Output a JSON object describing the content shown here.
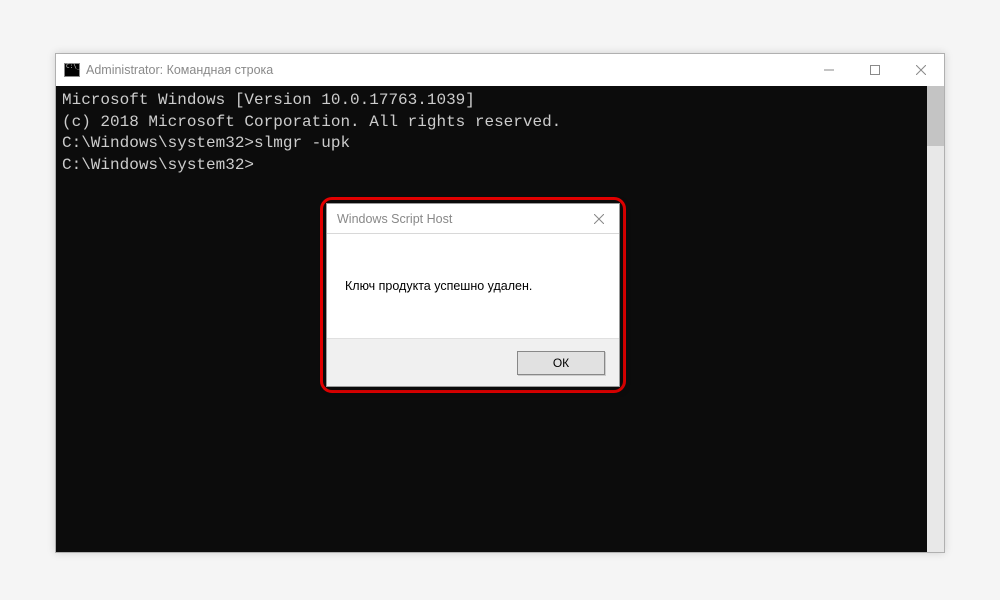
{
  "window": {
    "title": "Administrator: Командная строка"
  },
  "terminal": {
    "line1": "Microsoft Windows [Version 10.0.17763.1039]",
    "line2": "(c) 2018 Microsoft Corporation. All rights reserved.",
    "blank1": "",
    "prompt1": "C:\\Windows\\system32>",
    "command1": "slmgr -upk",
    "blank2": "",
    "prompt2": "C:\\Windows\\system32>"
  },
  "dialog": {
    "title": "Windows Script Host",
    "message": "Ключ продукта успешно удален.",
    "ok_label": "ОК"
  }
}
